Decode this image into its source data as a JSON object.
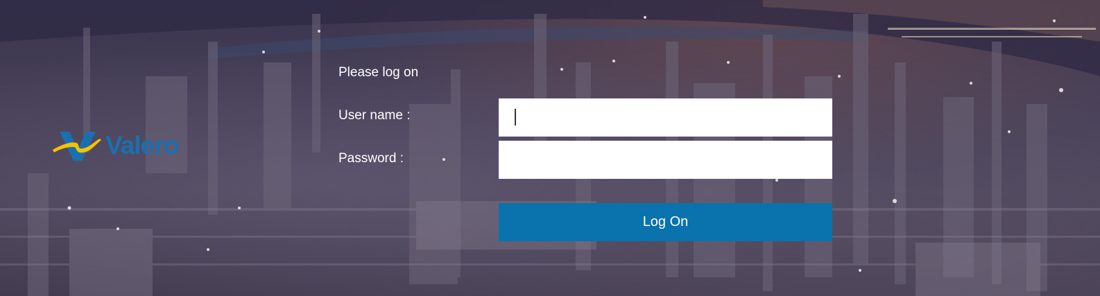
{
  "brand": {
    "logo_text": "Valero",
    "primary_color": "#1a6fb0",
    "accent_color": "#f4c300"
  },
  "form": {
    "title": "Please log on",
    "username_label": "User name :",
    "username_value": "",
    "password_label": "Password :",
    "password_value": "",
    "submit_label": "Log On",
    "submit_color": "#0a72ad"
  },
  "background": {
    "description_icon": "refinery-night-photo"
  }
}
